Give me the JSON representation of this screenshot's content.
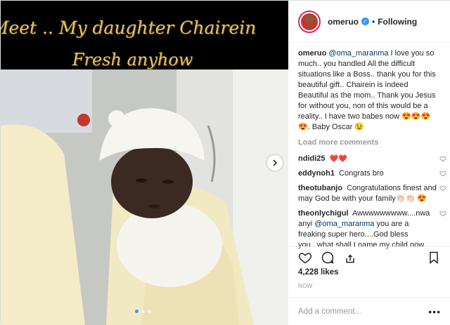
{
  "image": {
    "overlay_line_1": "Meet .. My daughter Chairein",
    "overlay_line_2": "Fresh anyhow",
    "carousel_dots": 3,
    "active_dot": 0
  },
  "header": {
    "username": "omeruo",
    "separator": "•",
    "follow_status": "Following"
  },
  "caption": {
    "user": "omeruo",
    "mention": "@oma_maranma",
    "text": " I love you so much.. you handled All the difficult situations like a Boss.. thank you for this beautiful gift.. Chairein is indeed Beautiful as the mom.. Thank you Jesus for without you, non of this would be a reality.. I have two babes now 😍😍😍😍. Baby Oscar 😉"
  },
  "load_more": "Load more comments",
  "comments": [
    {
      "user": "ndidi25",
      "text": "❤️❤️"
    },
    {
      "user": "eddynoh1",
      "text": "Congrats bro"
    },
    {
      "user": "theotubanjo",
      "text": "Congratulations finest and may God be with your family👏🏻👏🏻 😍"
    },
    {
      "user": "theonlychigul",
      "pre": "Awwwwwwwww....nwa anyi ",
      "mention": "@oma_maranma",
      "text": " you are a freaking super hero....God bless you...what shall I name my child now oh?"
    }
  ],
  "likes": "4,228 likes",
  "timestamp": "NOW",
  "add_comment_placeholder": "Add a comment...",
  "more_options": "•••",
  "colors": {
    "accent": "#3897f0",
    "heart": "#e0245e",
    "overlay_text": "#e7c25c"
  }
}
